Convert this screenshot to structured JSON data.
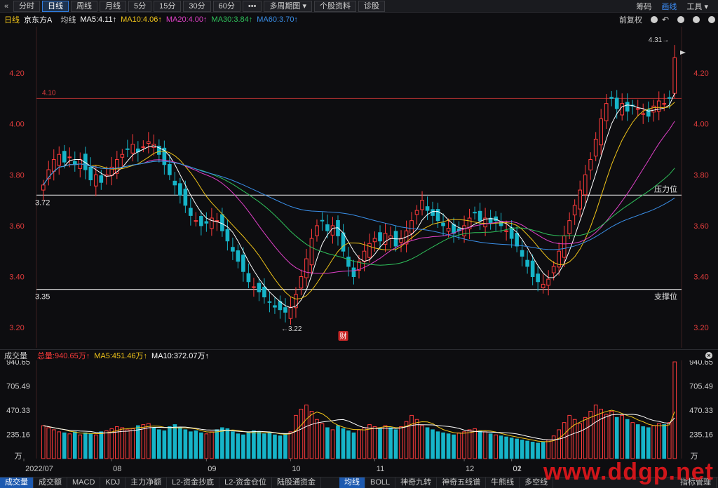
{
  "toolbar": {
    "back_icon": "double-chevron-left-icon",
    "periods": [
      "分时",
      "日线",
      "周线",
      "月线",
      "5分",
      "15分",
      "30分",
      "60分",
      "•••",
      "多周期图 ▾",
      "个股资料",
      "诊股"
    ],
    "active_period": 1,
    "right": [
      "筹码",
      "画线",
      "工具 ▾"
    ],
    "right_active": 1
  },
  "ma_bar": {
    "label": "日线",
    "stock": "京东方A",
    "type": "均线",
    "ma5": "MA5:4.11↑",
    "ma10": "MA10:4.06↑",
    "ma20": "MA20:4.00↑",
    "ma30": "MA30:3.84↑",
    "ma60": "MA60:3.70↑",
    "adjust": "前复权"
  },
  "colors": {
    "up": "#ff3b3b",
    "down": "#16b4c8",
    "ma5": "#ffffff",
    "ma10": "#f0c419",
    "ma20": "#e040c8",
    "ma30": "#2fc25b",
    "ma60": "#3a8fe8",
    "axis_red": "#e03c3c"
  },
  "price_axis": {
    "ticks": [
      "4.20",
      "4.00",
      "3.80",
      "3.60",
      "3.40",
      "3.20"
    ]
  },
  "annotations": {
    "line_410": "4.10",
    "high_label": "4.31→",
    "low_label": "←3.22",
    "resist_value": "3.72",
    "resist_label": "压力位",
    "support_value": "3.35",
    "support_label": "支撑位",
    "fin_badge": "财"
  },
  "volume": {
    "title": "成交量",
    "total": "总量:940.65万↑",
    "ma5": "MA5:451.46万↑",
    "ma10": "MA10:372.07万↑",
    "ticks": [
      "940.65",
      "705.49",
      "470.33",
      "235.16"
    ],
    "unit": "万"
  },
  "x_axis": {
    "labels": [
      "2022/07",
      "08",
      "09",
      "10",
      "11",
      "12",
      "01",
      "02"
    ]
  },
  "bottom_tabs": [
    "成交量",
    "成交额",
    "MACD",
    "KDJ",
    "主力净额",
    "L2-资金抄底",
    "L2-资金仓位",
    "陆股通资金",
    "均线",
    "BOLL",
    "神奇九转",
    "神奇五线谱",
    "牛熊线",
    "多空线"
  ],
  "bottom_active": [
    0,
    8
  ],
  "bottom_right": "指标管理",
  "watermark": "www.ddgp.net",
  "chart_data": {
    "type": "candlestick",
    "title": "京东方A",
    "ylim": [
      3.17,
      4.36
    ],
    "hlines": [
      4.1,
      3.72,
      3.35
    ],
    "high": 4.31,
    "low": 3.22,
    "months": [
      "2022/07",
      "08",
      "09",
      "10",
      "11",
      "12",
      "01",
      "02"
    ],
    "close": [
      3.76,
      3.82,
      3.86,
      3.88,
      3.85,
      3.87,
      3.84,
      3.86,
      3.82,
      3.78,
      3.8,
      3.77,
      3.8,
      3.83,
      3.86,
      3.88,
      3.9,
      3.92,
      3.89,
      3.91,
      3.93,
      3.92,
      3.88,
      3.84,
      3.8,
      3.76,
      3.72,
      3.68,
      3.64,
      3.62,
      3.6,
      3.61,
      3.63,
      3.62,
      3.58,
      3.54,
      3.5,
      3.46,
      3.42,
      3.38,
      3.36,
      3.34,
      3.32,
      3.3,
      3.28,
      3.27,
      3.26,
      3.28,
      3.33,
      3.4,
      3.47,
      3.55,
      3.6,
      3.62,
      3.58,
      3.6,
      3.56,
      3.5,
      3.44,
      3.4,
      3.46,
      3.5,
      3.53,
      3.55,
      3.54,
      3.57,
      3.56,
      3.52,
      3.55,
      3.58,
      3.62,
      3.66,
      3.7,
      3.66,
      3.64,
      3.62,
      3.6,
      3.59,
      3.57,
      3.58,
      3.6,
      3.63,
      3.65,
      3.62,
      3.63,
      3.61,
      3.62,
      3.6,
      3.58,
      3.55,
      3.52,
      3.48,
      3.44,
      3.4,
      3.38,
      3.37,
      3.39,
      3.44,
      3.5,
      3.56,
      3.62,
      3.68,
      3.74,
      3.8,
      3.86,
      3.94,
      4.02,
      4.08,
      4.1,
      4.06,
      4.08,
      4.05,
      4.07,
      4.06,
      4.04,
      4.03,
      4.07,
      4.09,
      4.08,
      4.1,
      4.26
    ],
    "volume": [
      320,
      300,
      280,
      260,
      250,
      240,
      260,
      230,
      250,
      240,
      230,
      260,
      270,
      290,
      310,
      300,
      280,
      290,
      320,
      330,
      340,
      300,
      280,
      270,
      310,
      330,
      300,
      280,
      260,
      270,
      250,
      240,
      260,
      280,
      300,
      290,
      260,
      240,
      230,
      250,
      270,
      260,
      240,
      250,
      230,
      220,
      240,
      260,
      420,
      480,
      520,
      460,
      380,
      340,
      300,
      280,
      320,
      290,
      270,
      250,
      280,
      300,
      330,
      310,
      290,
      320,
      300,
      280,
      310,
      360,
      420,
      380,
      320,
      300,
      280,
      260,
      250,
      240,
      230,
      250,
      260,
      280,
      290,
      270,
      260,
      240,
      230,
      220,
      210,
      200,
      190,
      180,
      170,
      160,
      150,
      160,
      180,
      220,
      280,
      350,
      420,
      380,
      340,
      400,
      460,
      520,
      480,
      430,
      460,
      400,
      420,
      380,
      350,
      330,
      310,
      300,
      320,
      340,
      330,
      350,
      940
    ]
  }
}
